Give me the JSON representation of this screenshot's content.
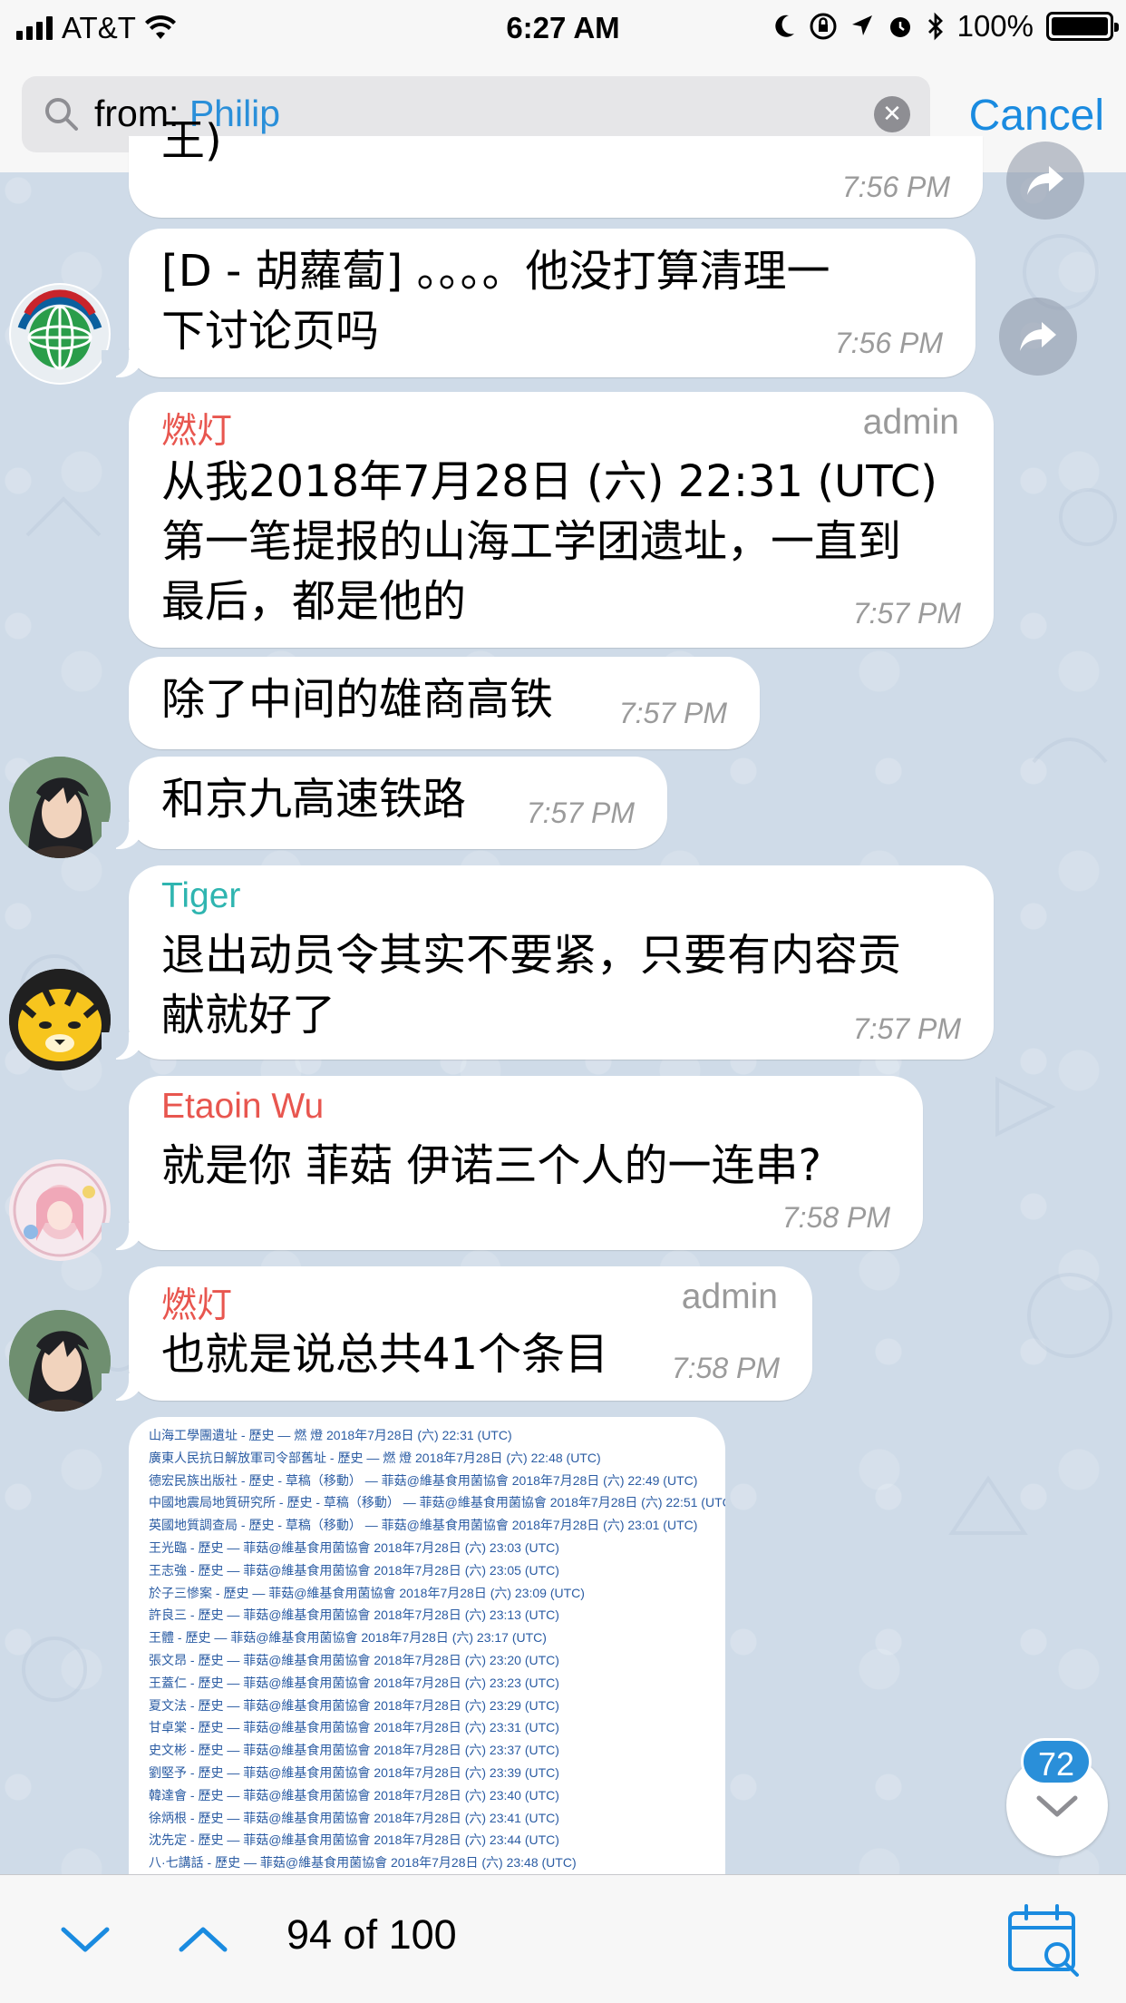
{
  "status_bar": {
    "carrier": "AT&T",
    "time": "6:27 AM",
    "battery": "100%"
  },
  "search": {
    "prefix": "from:",
    "user": "Philip",
    "cancel_label": "Cancel"
  },
  "messages": [
    {
      "text_partial": "王)",
      "time": "7:56 PM"
    },
    {
      "text": "[D - 胡蘿蔔] 。。。。他没打算清理一下讨论页吗",
      "line1": "[D - 胡蘿蔔] 。。。。他没打算清理一",
      "line2": "下讨论页吗",
      "time": "7:56 PM"
    },
    {
      "sender": "燃灯",
      "role": "admin",
      "line1": "从我2018年7月28日 (六) 22:31 (UTC)",
      "line2": "第一笔提报的山海工学团遗址，一直到",
      "line3": "最后，都是他的",
      "time": "7:57 PM"
    },
    {
      "text": "除了中间的雄商高铁",
      "time": "7:57 PM"
    },
    {
      "text": "和京九高速铁路",
      "time": "7:57 PM"
    },
    {
      "sender": "Tiger",
      "line1": "退出动员令其实不要紧，只要有内容贡",
      "line2": "献就好了",
      "time": "7:57 PM"
    },
    {
      "sender": "Etaoin Wu",
      "text": "就是你 菲菇 伊诺三个人的一连串?",
      "time": "7:58 PM"
    },
    {
      "sender": "燃灯",
      "role": "admin",
      "text": "也就是说总共41个条目",
      "time": "7:58 PM"
    }
  ],
  "image_list": [
    "山海工學團遺址 - 歷史 — 燃 燈 2018年7月28日 (六) 22:31 (UTC)",
    "廣東人民抗日解放軍司令部舊址 - 歷史 — 燃 燈 2018年7月28日 (六) 22:48 (UTC)",
    "德宏民族出版社 - 歷史 - 草稿（移動） — 菲菇@維基食用菌協會 2018年7月28日 (六) 22:49 (UTC)",
    "中國地震局地質研究所 - 歷史 - 草稿（移動） — 菲菇@維基食用菌協會 2018年7月28日 (六) 22:51 (UTC)",
    "英國地質調查局 - 歷史 - 草稿（移動） — 菲菇@維基食用菌協會 2018年7月28日 (六) 23:01 (UTC)",
    "王光臨 - 歷史 — 菲菇@維基食用菌協會 2018年7月28日 (六) 23:03 (UTC)",
    "王志強 - 歷史 — 菲菇@維基食用菌協會 2018年7月28日 (六) 23:05 (UTC)",
    "於子三慘案 - 歷史 — 菲菇@維基食用菌協會 2018年7月28日 (六) 23:09 (UTC)",
    "許良三 - 歷史 — 菲菇@維基食用菌協會 2018年7月28日 (六) 23:13 (UTC)",
    "王體 - 歷史 — 菲菇@維基食用菌協會 2018年7月28日 (六) 23:17 (UTC)",
    "張文昂 - 歷史 — 菲菇@維基食用菌協會 2018年7月28日 (六) 23:20 (UTC)",
    "王蓋仁 - 歷史 — 菲菇@維基食用菌協會 2018年7月28日 (六) 23:23 (UTC)",
    "夏文法 - 歷史 — 菲菇@維基食用菌協會 2018年7月28日 (六) 23:29 (UTC)",
    "甘卓棠 - 歷史 — 菲菇@維基食用菌協會 2018年7月28日 (六) 23:31 (UTC)",
    "史文彬 - 歷史 — 菲菇@維基食用菌協會 2018年7月28日 (六) 23:37 (UTC)",
    "劉堅予 - 歷史 — 菲菇@維基食用菌協會 2018年7月28日 (六) 23:39 (UTC)",
    "韓達會 - 歷史 — 菲菇@維基食用菌協會 2018年7月28日 (六) 23:40 (UTC)",
    "徐炳根 - 歷史 — 菲菇@維基食用菌協會 2018年7月28日 (六) 23:41 (UTC)",
    "沈先定 - 歷史 — 菲菇@維基食用菌協會 2018年7月28日 (六) 23:44 (UTC)",
    "八·七講話 - 歷史 — 菲菇@維基食用菌協會 2018年7月28日 (六) 23:48 (UTC)"
  ],
  "unread_count": "72",
  "bottom_bar": {
    "result_text": "94 of 100"
  },
  "colors": {
    "accent": "#2a8fd9",
    "sender_red": "#e8564f",
    "sender_teal": "#2fb5b0",
    "sender_salmon": "#e8564f",
    "chat_bg": "#cfdbe8"
  },
  "icons": [
    "search-icon",
    "clear-icon",
    "share-icon",
    "chevron-down-icon",
    "chevron-up-icon",
    "calendar-search-icon",
    "wifi-icon",
    "moon-icon",
    "rotation-lock-icon",
    "location-icon",
    "alarm-icon",
    "bluetooth-icon"
  ]
}
